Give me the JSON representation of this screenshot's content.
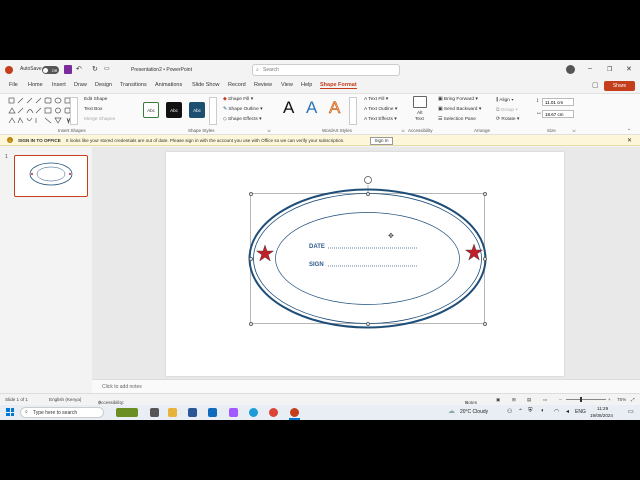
{
  "titlebar": {
    "autosave_label": "AutoSave",
    "autosave_state": "Off",
    "doc_title": "Presentation2 • PowerPoint",
    "search_placeholder": "Search"
  },
  "menu": {
    "tabs": [
      "File",
      "Home",
      "Insert",
      "Draw",
      "Design",
      "Transitions",
      "Animations",
      "Slide Show",
      "Record",
      "Review",
      "View",
      "Help",
      "Shape Format"
    ],
    "active_tab": "Shape Format",
    "share_label": "Share"
  },
  "ribbon": {
    "insert_shapes": {
      "label": "Insert Shapes",
      "edit_shape": "Edit Shape",
      "text_box": "Text Box",
      "merge_shapes": "Merge Shapes"
    },
    "shape_styles": {
      "label": "Shape Styles",
      "style_sample": "Abc",
      "shape_fill": "Shape Fill",
      "shape_outline": "Shape Outline",
      "shape_effects": "Shape Effects"
    },
    "wordart": {
      "label": "WordArt Styles",
      "sample": "A",
      "text_fill": "Text Fill",
      "text_outline": "Text Outline",
      "text_effects": "Text Effects"
    },
    "accessibility": {
      "label": "Accessibility",
      "alt_text_line1": "Alt",
      "alt_text_line2": "Text"
    },
    "arrange": {
      "label": "Arrange",
      "bring_forward": "Bring Forward",
      "send_backward": "Send Backward",
      "selection_pane": "Selection Pane",
      "align": "Align",
      "group": "Group",
      "rotate": "Rotate"
    },
    "size": {
      "label": "Size",
      "height": "11.01 cm",
      "width": "18.67 cm"
    }
  },
  "infobar": {
    "title": "SIGN IN TO OFFICE",
    "message": "It looks like your stored credentials are out of date. Please sign in with the account you use with Office so we can verify your subscription.",
    "button": "Sign In"
  },
  "thumbnails": [
    {
      "number": "1"
    }
  ],
  "slide": {
    "date_label": "DATE",
    "sign_label": "SIGN"
  },
  "notes_placeholder": "Click to add notes",
  "statusbar": {
    "slide_info": "Slide 1 of 1",
    "language": "English (Kenya)",
    "accessibility": "Accessibility: Investigate",
    "notes": "Notes",
    "zoom": "75%"
  },
  "taskbar": {
    "search_placeholder": "Type here to search",
    "weather": "20°C  Cloudy",
    "language": "ENG",
    "time": "11:29",
    "date": "19/08/2024"
  },
  "colors": {
    "accent": "#c43e1c",
    "ellipse_stroke": "#1f4e79",
    "label_color": "#2e5b8a",
    "star": "#c0202a"
  }
}
